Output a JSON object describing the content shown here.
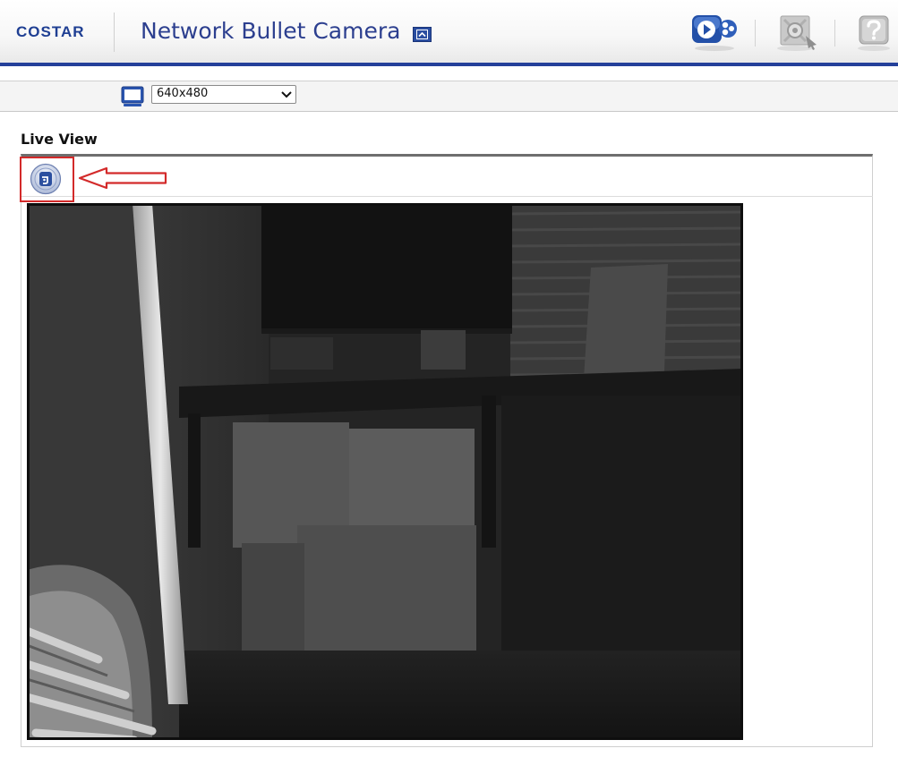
{
  "header": {
    "logo_text": "COSTAR",
    "product_title": "Network Bullet Camera",
    "icons": {
      "live_view": "live-view-icon",
      "setup": "setup-icon",
      "help": "help-icon"
    }
  },
  "toolbar": {
    "stream_icon": "monitor-icon",
    "resolution": {
      "selected": "640x480"
    }
  },
  "live_view": {
    "title": "Live View",
    "ptz_icon": "ptz-control-icon"
  },
  "colors": {
    "brand_blue": "#24409a",
    "annotation_red": "#d32a2a"
  }
}
